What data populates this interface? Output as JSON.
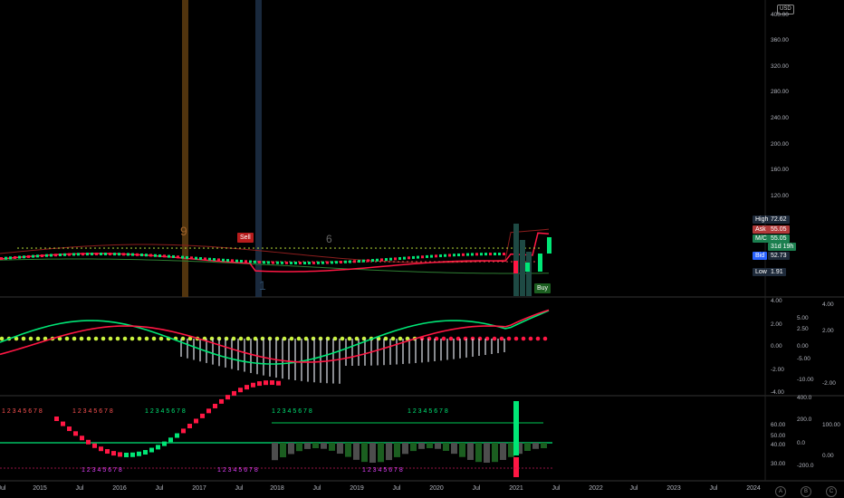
{
  "currency": "USD",
  "price_axis": [
    "400.00",
    "360.00",
    "320.00",
    "280.00",
    "240.00",
    "200.00",
    "160.00",
    "120.00"
  ],
  "price_tags": {
    "high": {
      "label": "High",
      "value": "72.62"
    },
    "ask": {
      "label": "Ask",
      "value": "55.05"
    },
    "mc": {
      "label": "M/C",
      "value": "55.05",
      "sub": "31d 19h"
    },
    "bid": {
      "label": "Bid",
      "value": "52.73"
    },
    "low": {
      "label": "Low",
      "value": "1.91"
    }
  },
  "signals": {
    "sell": "Sell",
    "buy": "Buy"
  },
  "markers": {
    "nine": "9",
    "one": "1",
    "six": "6"
  },
  "osc1_axis_a": [
    "4.00",
    "2.00",
    "0.00",
    "-2.00",
    "-4.00"
  ],
  "osc1_axis_b": [
    "5.00",
    "2.50",
    "0.00",
    "-5.00",
    "-10.00"
  ],
  "osc1_axis_c": [
    "4.00",
    "2.00",
    "-2.00"
  ],
  "osc2_axis_a": [
    "60.00",
    "50.00",
    "40.00",
    "30.00"
  ],
  "osc2_axis_b": [
    "400.0",
    "200.0",
    "0.0",
    "-200.0"
  ],
  "osc2_axis_c": [
    "100.00",
    "0.00"
  ],
  "seq_top": "1 2 3 4 5 6 7 8",
  "seq_bottom": "1 2 3 4 5 6 7 8",
  "time_axis": [
    "Jul",
    "2015",
    "Jul",
    "2016",
    "Jul",
    "2017",
    "Jul",
    "2018",
    "Jul",
    "2019",
    "Jul",
    "2020",
    "Jul",
    "2021",
    "Jul",
    "2022",
    "Jul",
    "2023",
    "Jul",
    "2024"
  ],
  "scale_buttons": [
    "A",
    "B",
    "C"
  ],
  "colors": {
    "bg": "#000000",
    "up": "#00e676",
    "down": "#ff1744",
    "grid": "#1a1a1a",
    "white": "#d1d4dc",
    "yellow": "#c9f23f",
    "blue": "#42a5f5"
  }
}
